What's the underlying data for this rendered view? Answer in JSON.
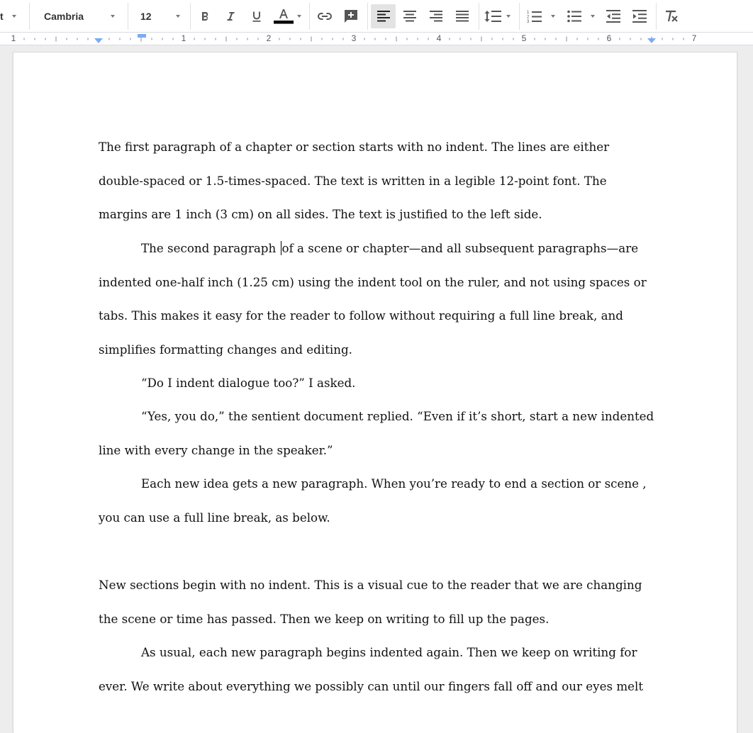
{
  "toolbar": {
    "style_partial": "t",
    "font_name": "Cambria",
    "font_size": "12",
    "text_color": "#000000"
  },
  "ruler": {
    "numbers": [
      "1",
      "1",
      "2",
      "3",
      "4",
      "5",
      "6",
      "7"
    ]
  },
  "document": {
    "p1": [
      "The first paragraph of a chapter or section starts with no indent. The lines are either",
      "double-spaced or 1.5-times-spaced. The text is written in a legible 12-point font. The",
      "margins are 1 inch (3 cm) on all sides. The text is justified to the left side."
    ],
    "p2_first_before_cursor": "The second paragraph ",
    "p2_first_after_cursor": "of a scene or chapter—and all subsequent paragraphs—are",
    "p2": [
      "indented one-half inch (1.25 cm) using the indent tool on the ruler, and not using spaces or",
      "tabs. This makes it easy for the reader to follow without requiring a full line break, and",
      "simplifies formatting changes and editing."
    ],
    "p3": "“Do I indent dialogue too?” I asked.",
    "p4": [
      "“Yes, you do,” the sentient document replied. “Even if it’s short, start a new indented",
      "line with every change in the speaker.”"
    ],
    "p5": [
      "Each new idea gets a new paragraph. When you’re ready to end a section or scene ,",
      "you can use a full line break, as below."
    ],
    "p6": [
      "New sections begin with no indent. This is a visual cue to the reader that we are changing",
      "the scene or time has passed. Then we keep on writing to fill up the pages."
    ],
    "p7": [
      "As usual, each new paragraph begins indented again. Then we keep on writing for",
      "ever. We write about everything we possibly can until our fingers fall off and our eyes melt"
    ]
  }
}
